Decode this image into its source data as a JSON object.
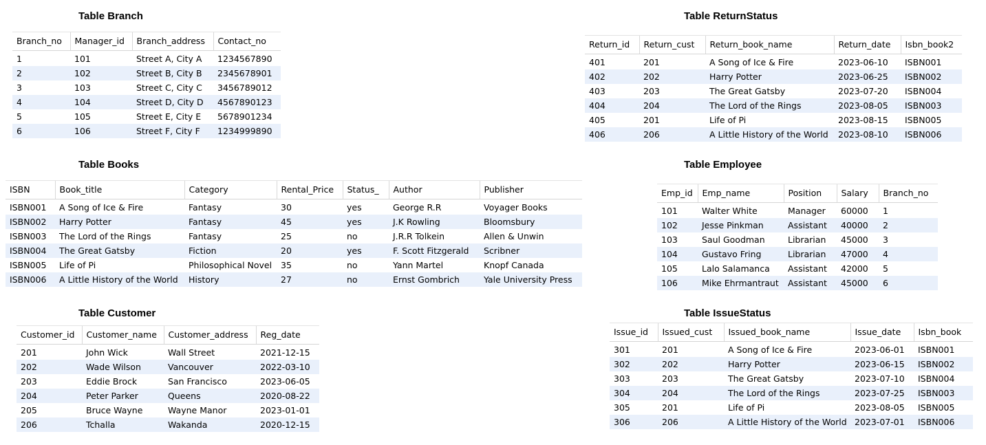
{
  "tables": [
    {
      "title": "Table Branch",
      "columns": [
        "Branch_no",
        "Manager_id",
        "Branch_address",
        "Contact_no"
      ],
      "rows": [
        [
          "1",
          "101",
          "Street A, City A",
          "1234567890"
        ],
        [
          "2",
          "102",
          "Street B, City B",
          "2345678901"
        ],
        [
          "3",
          "103",
          "Street C, City C",
          "3456789012"
        ],
        [
          "4",
          "104",
          "Street D, City D",
          "4567890123"
        ],
        [
          "5",
          "105",
          "Street E, City E",
          "5678901234"
        ],
        [
          "6",
          "106",
          "Street F, City F",
          "1234999890"
        ]
      ]
    },
    {
      "title": "Table ReturnStatus",
      "columns": [
        "Return_id",
        "Return_cust",
        "Return_book_name",
        "Return_date",
        "Isbn_book2"
      ],
      "rows": [
        [
          "401",
          "201",
          "A Song of Ice & Fire",
          "2023-06-10",
          "ISBN001"
        ],
        [
          "402",
          "202",
          "Harry Potter",
          "2023-06-25",
          "ISBN002"
        ],
        [
          "403",
          "203",
          "The Great Gatsby",
          "2023-07-20",
          "ISBN004"
        ],
        [
          "404",
          "204",
          "The Lord of the Rings",
          "2023-08-05",
          "ISBN003"
        ],
        [
          "405",
          "201",
          "Life of Pi",
          "2023-08-15",
          "ISBN005"
        ],
        [
          "406",
          "206",
          "A Little History of the World",
          "2023-08-10",
          "ISBN006"
        ]
      ]
    },
    {
      "title": "Table Books",
      "columns": [
        "ISBN",
        "Book_title",
        "Category",
        "Rental_Price",
        "Status_",
        "Author",
        "Publisher"
      ],
      "rows": [
        [
          "ISBN001",
          "A Song of Ice & Fire",
          "Fantasy",
          "30",
          "yes",
          "George R.R",
          "Voyager Books"
        ],
        [
          "ISBN002",
          "Harry Potter",
          "Fantasy",
          "45",
          "yes",
          "J.K Rowling",
          "Bloomsbury"
        ],
        [
          "ISBN003",
          "The Lord of the Rings",
          "Fantasy",
          "25",
          "no",
          "J.R.R Tolkein",
          "Allen & Unwin"
        ],
        [
          "ISBN004",
          "The Great Gatsby",
          "Fiction",
          "20",
          "yes",
          "F. Scott Fitzgerald",
          "Scribner"
        ],
        [
          "ISBN005",
          "Life of Pi",
          "Philosophical Novel",
          "35",
          "no",
          "Yann Martel",
          "Knopf Canada"
        ],
        [
          "ISBN006",
          "A Little History of the World",
          "History",
          "27",
          "no",
          "Ernst Gombrich",
          "Yale University Press"
        ]
      ]
    },
    {
      "title": "Table Employee",
      "columns": [
        "Emp_id",
        "Emp_name",
        "Position",
        "Salary",
        "Branch_no"
      ],
      "rows": [
        [
          "101",
          "Walter White",
          "Manager",
          "60000",
          "1"
        ],
        [
          "102",
          "Jesse Pinkman",
          "Assistant",
          "40000",
          "2"
        ],
        [
          "103",
          "Saul Goodman",
          "Librarian",
          "45000",
          "3"
        ],
        [
          "104",
          "Gustavo Fring",
          "Librarian",
          "47000",
          "4"
        ],
        [
          "105",
          "Lalo Salamanca",
          "Assistant",
          "42000",
          "5"
        ],
        [
          "106",
          "Mike Ehrmantraut",
          "Assistant",
          "45000",
          "6"
        ]
      ]
    },
    {
      "title": "Table Customer",
      "columns": [
        "Customer_id",
        "Customer_name",
        "Customer_address",
        "Reg_date"
      ],
      "rows": [
        [
          "201",
          "John Wick",
          "Wall Street",
          "2021-12-15"
        ],
        [
          "202",
          "Wade Wilson",
          "Vancouver",
          "2022-03-10"
        ],
        [
          "203",
          "Eddie Brock",
          "San Francisco",
          "2023-06-05"
        ],
        [
          "204",
          "Peter Parker",
          "Queens",
          "2020-08-22"
        ],
        [
          "205",
          "Bruce Wayne",
          "Wayne Manor",
          "2023-01-01"
        ],
        [
          "206",
          "Tchalla",
          "Wakanda",
          "2020-12-15"
        ]
      ]
    },
    {
      "title": "Table IssueStatus",
      "columns": [
        "Issue_id",
        "Issued_cust",
        "Issued_book_name",
        "Issue_date",
        "Isbn_book"
      ],
      "rows": [
        [
          "301",
          "201",
          "A Song of Ice & Fire",
          "2023-06-01",
          "ISBN001"
        ],
        [
          "302",
          "202",
          "Harry Potter",
          "2023-06-15",
          "ISBN002"
        ],
        [
          "303",
          "203",
          "The Great Gatsby",
          "2023-07-10",
          "ISBN004"
        ],
        [
          "304",
          "204",
          "The Lord of the Rings",
          "2023-07-25",
          "ISBN003"
        ],
        [
          "305",
          "201",
          "Life of Pi",
          "2023-08-05",
          "ISBN005"
        ],
        [
          "306",
          "206",
          "A Little History of the World",
          "2023-07-01",
          "ISBN006"
        ]
      ]
    }
  ]
}
